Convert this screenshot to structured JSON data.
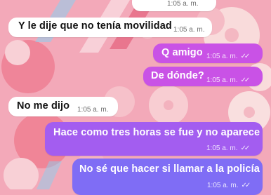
{
  "conversation": {
    "messages": [
      {
        "direction": "incoming",
        "text": "",
        "time": "1:05 a. m."
      },
      {
        "direction": "incoming",
        "text": "Y le dije que no tenía movilidad",
        "time": "1:05 a. m."
      },
      {
        "direction": "outgoing",
        "text": "Q amigo",
        "time": "1:05 a. m.",
        "status_icon": "double-check-icon"
      },
      {
        "direction": "outgoing",
        "text": "De dónde?",
        "time": "1:05 a. m.",
        "status_icon": "double-check-icon"
      },
      {
        "direction": "incoming",
        "text": "No me dijo",
        "time": "1:05 a. m."
      },
      {
        "direction": "outgoing",
        "text": "Hace como tres horas se fue y no aparece",
        "time": "1:05 a. m.",
        "status_icon": "double-check-icon"
      },
      {
        "direction": "outgoing",
        "text": "No sé que hacer si llamar a la policía",
        "time": "1:05 a. m.",
        "status_icon": "double-check-icon"
      }
    ]
  },
  "ticks_glyph": "✓✓",
  "theme": {
    "wallpaper": "#f3a9b9",
    "incoming_bubble": "#ffffff",
    "outgoing_bubble_top": "#c952e6",
    "outgoing_bubble_mid": "#a35df0",
    "outgoing_bubble_bottom": "#7f6df5"
  }
}
